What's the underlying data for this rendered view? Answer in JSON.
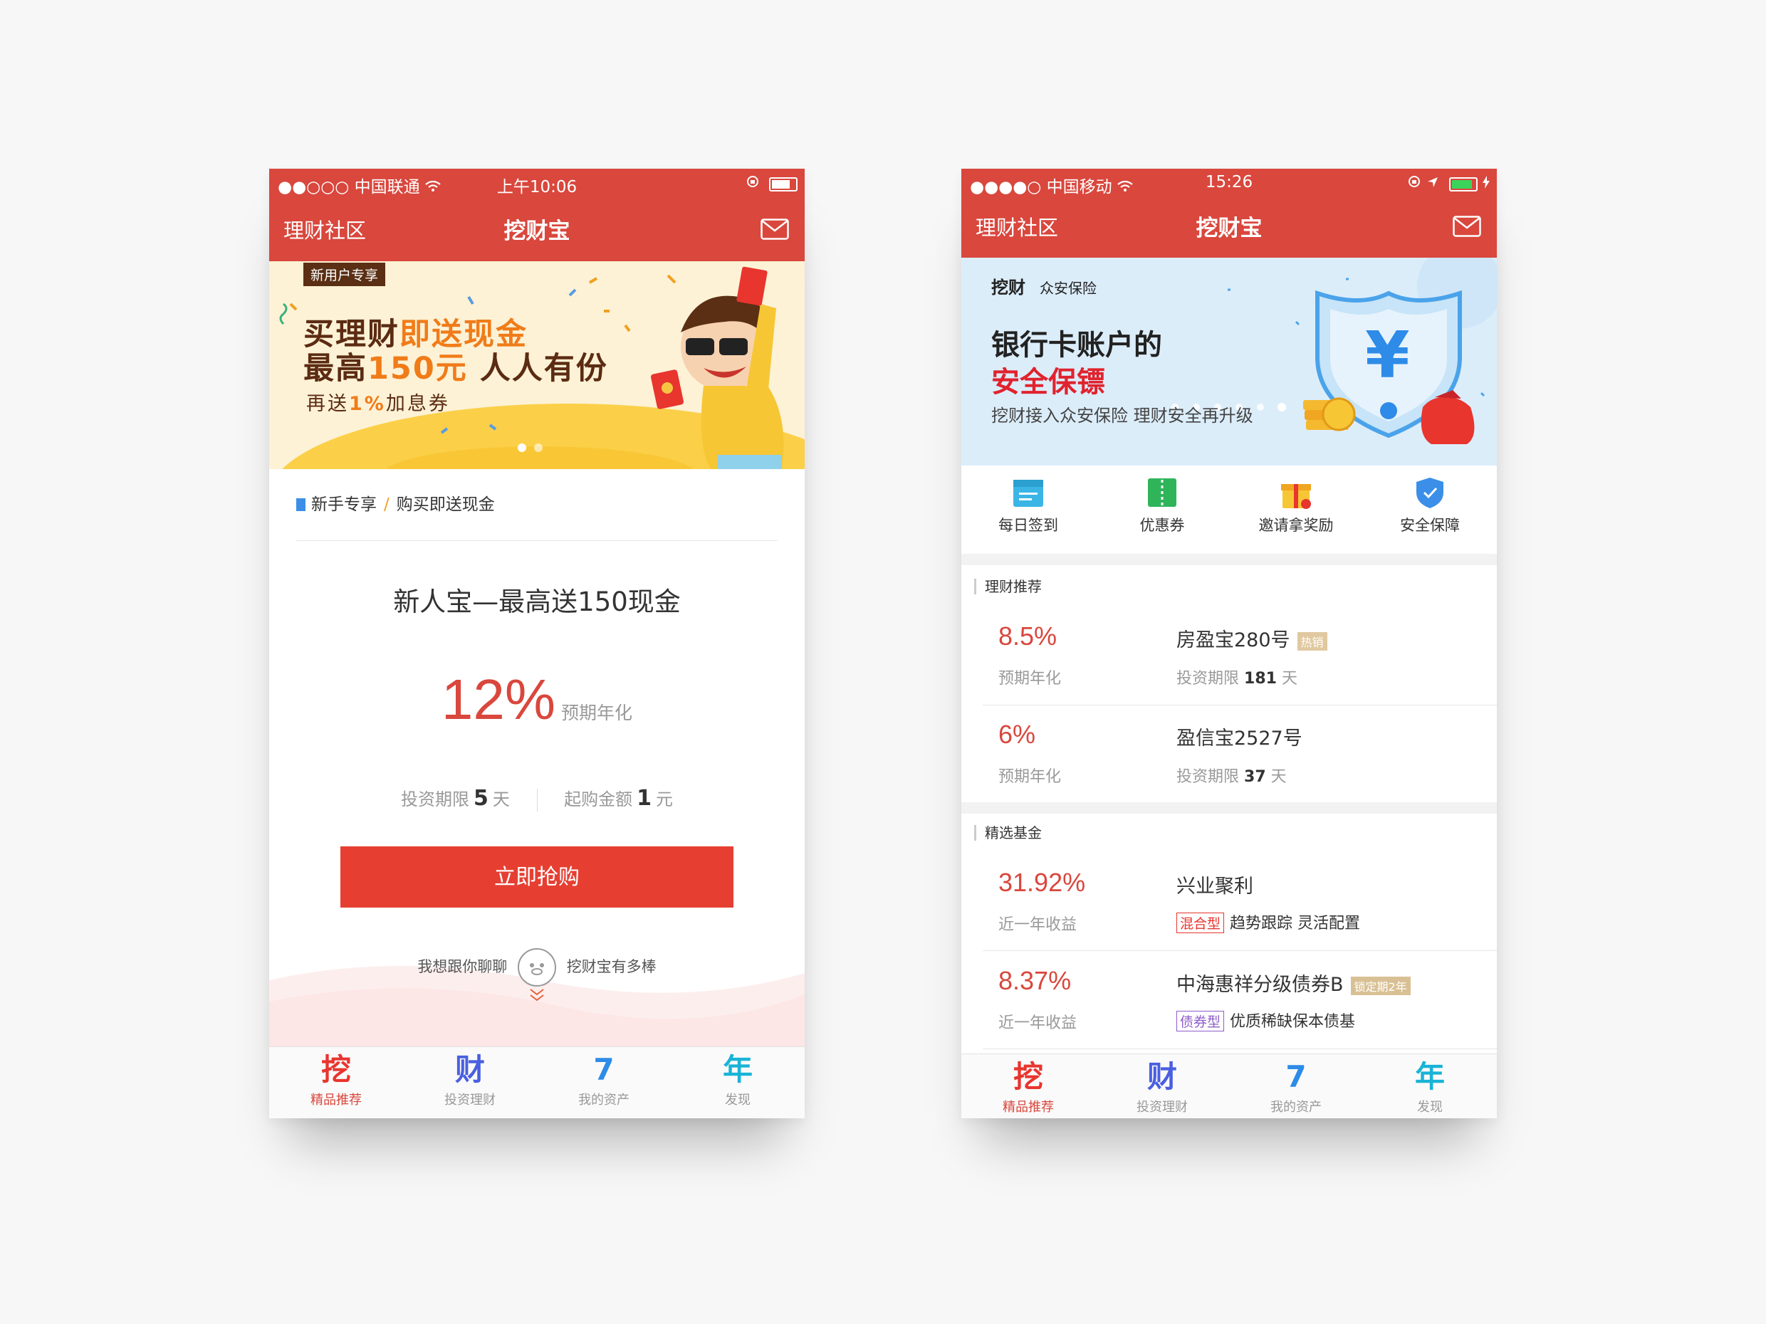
{
  "left": {
    "status": {
      "signal": "●●○○○",
      "carrier": "中国联通",
      "time": "上午10:06"
    },
    "nav": {
      "left": "理财社区",
      "title": "挖财宝"
    },
    "banner": {
      "badge": "新用户专享",
      "line1a": "买理财",
      "line1b": "即送现金",
      "line2a": "最高",
      "line2b": "150元",
      "line2c": " 人人有份",
      "line3a": "再送",
      "line3b": "1%",
      "line3c": "加息券"
    },
    "crumb": {
      "section": "新手专享",
      "sep": "/",
      "page": "购买即送现金"
    },
    "product": {
      "title": "新人宝—最高送150现金",
      "rate": "12%",
      "rate_label": "预期年化",
      "term_label": "投资期限",
      "term_value": "5",
      "term_unit": "天",
      "min_label": "起购金额",
      "min_value": "1",
      "min_unit": "元"
    },
    "buy_button": "立即抢购",
    "chat": {
      "left": "我想跟你聊聊",
      "right": "挖财宝有多棒"
    },
    "tabs": [
      {
        "glyph": "挖",
        "label": "精品推荐",
        "color": "#e8352e"
      },
      {
        "glyph": "财",
        "label": "投资理财",
        "color": "#4a5fe0"
      },
      {
        "glyph": "7",
        "label": "我的资产",
        "color": "#2e8be8"
      },
      {
        "glyph": "年",
        "label": "发现",
        "color": "#19b3d6"
      }
    ]
  },
  "right": {
    "status": {
      "signal": "●●●●○",
      "carrier": "中国移动",
      "time": "15:26"
    },
    "nav": {
      "left": "理财社区",
      "title": "挖财宝"
    },
    "banner": {
      "logo1": "挖财",
      "logo2": "众安保险",
      "line1": "银行卡账户的",
      "line2": "安全保镖",
      "line3": "挖财接入众安保险 理财安全再升级",
      "currency": "¥"
    },
    "quick": [
      {
        "label": "每日签到",
        "icon": "calendar-icon"
      },
      {
        "label": "优惠券",
        "icon": "coupon-icon"
      },
      {
        "label": "邀请拿奖励",
        "icon": "gift-icon"
      },
      {
        "label": "安全保障",
        "icon": "shield-icon"
      }
    ],
    "finance": {
      "title": "理财推荐",
      "items": [
        {
          "rate": "8.5%",
          "rate_label": "预期年化",
          "name": "房盈宝280号",
          "tag": "热销",
          "term_label": "投资期限",
          "term": "181",
          "unit": "天"
        },
        {
          "rate": "6%",
          "rate_label": "预期年化",
          "name": "盈信宝2527号",
          "tag": "",
          "term_label": "投资期限",
          "term": "37",
          "unit": "天"
        }
      ]
    },
    "funds": {
      "title": "精选基金",
      "items": [
        {
          "rate": "31.92%",
          "rate_label": "近一年收益",
          "name": "兴业聚利",
          "tag": "",
          "type": "混合型",
          "desc": "趋势跟踪 灵活配置"
        },
        {
          "rate": "8.37%",
          "rate_label": "近一年收益",
          "name": "中海惠祥分级债券B",
          "tag": "锁定期2年",
          "type": "债券型",
          "desc": "优质稀缺保本债基"
        }
      ]
    },
    "tabs": [
      {
        "glyph": "挖",
        "label": "精品推荐",
        "color": "#e8352e"
      },
      {
        "glyph": "财",
        "label": "投资理财",
        "color": "#4a5fe0"
      },
      {
        "glyph": "7",
        "label": "我的资产",
        "color": "#2e8be8"
      },
      {
        "glyph": "年",
        "label": "发现",
        "color": "#19b3d6"
      }
    ]
  }
}
